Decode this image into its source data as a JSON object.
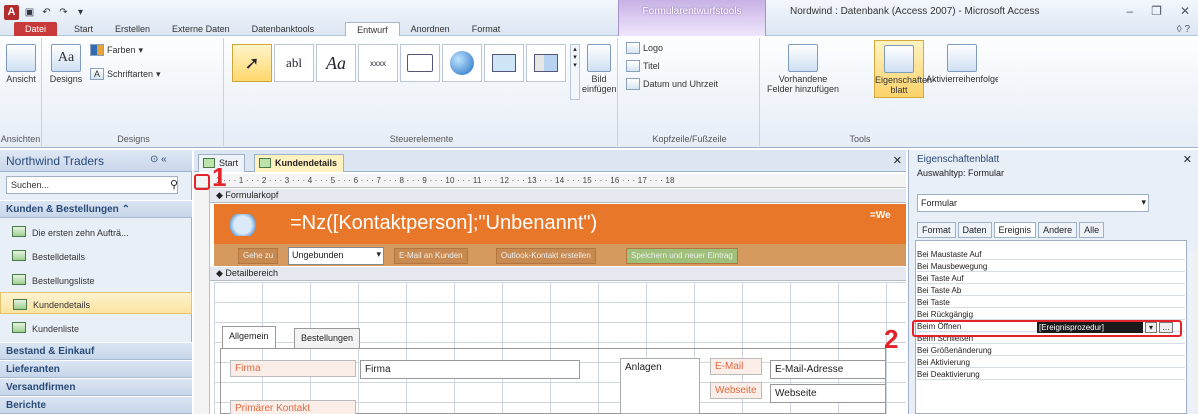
{
  "window": {
    "title": "Nordwind : Datenbank (Access 2007) - Microsoft Access",
    "context_tab_title": "Formularentwurfstools",
    "app_icon_label": "A"
  },
  "ribbon_tabs": [
    "Datei",
    "Start",
    "Erstellen",
    "Externe Daten",
    "Datenbanktools",
    "Entwurf",
    "Anordnen",
    "Format"
  ],
  "active_ribbon_tab": "Entwurf",
  "ribbon": {
    "ansichten": {
      "label": "Ansichten",
      "button": "Ansicht"
    },
    "designs": {
      "label": "Designs",
      "designs_btn": "Designs",
      "farben": "Farben",
      "schriftarten": "Schriftarten"
    },
    "steuerelemente": {
      "label": "Steuerelemente",
      "bild_einfuegen": "Bild einfügen",
      "ab_label": "abl",
      "aa_label": "Aa",
      "xxxx_label": "xxxx"
    },
    "kopfzeile": {
      "label": "Kopfzeile/Fußzeile",
      "logo": "Logo",
      "titel": "Titel",
      "datum": "Datum und Uhrzeit"
    },
    "tools": {
      "label": "Tools",
      "vorhandene": "Vorhandene Felder hinzufügen",
      "eigenschaften": "Eigenschaften-blatt",
      "aktivierreihenfolge": "Aktivierreihenfolge"
    }
  },
  "nav": {
    "title": "Northwind Traders",
    "search_placeholder": "Suchen...",
    "section_open": "Kunden & Bestellungen",
    "items": [
      "Die ersten zehn Aufträ...",
      "Bestelldetails",
      "Bestellungsliste",
      "Kundendetails",
      "Kundenliste"
    ],
    "selected_index": 3,
    "sections": [
      "Bestand & Einkauf",
      "Lieferanten",
      "Versandfirmen",
      "Berichte"
    ]
  },
  "document": {
    "tabs": [
      "Start",
      "Kundendetails"
    ],
    "active_tab": "Kundendetails",
    "ruler": "1 · · · 1 · · · 2 · · · 3 · · · 4 · · · 5 · · · 6 · · · 7 · · · 8 · · · 9 · · · 10 · · · 11 · · · 12 · · · 13 · · · 14 · · · 15 · · · 16 · · · 17 · · · 18",
    "section_formularkopf": "Formularkopf",
    "section_detailbereich": "Detailbereich",
    "header_expression": "=Nz([Kontaktperson];\"Unbenannt\")",
    "header_right": "=We",
    "gehe_zu": "Gehe zu",
    "combo_value": "Ungebunden",
    "buttons": [
      "E-Mail an Kunden",
      "Outlook-Kontakt erstellen",
      "Speichern und neuer Eintrag"
    ],
    "form_tabs": [
      "Allgemein",
      "Bestellungen"
    ],
    "fields": {
      "firma_label": "Firma",
      "firma_value": "Firma",
      "kontakt_label": "Primärer Kontakt",
      "anlagen": "Anlagen",
      "email_label": "E-Mail",
      "email_value": "E-Mail-Adresse",
      "webseite_label": "Webseite",
      "webseite_value": "Webseite"
    }
  },
  "properties": {
    "title": "Eigenschaftenblatt",
    "auswahltyp": "Auswahltyp: Formular",
    "object": "Formular",
    "tabs": [
      "Format",
      "Daten",
      "Ereignis",
      "Andere",
      "Alle"
    ],
    "active_tab": "Ereignis",
    "rows": [
      "Bei Maustaste Auf",
      "Bei Mausbewegung",
      "Bei Taste Auf",
      "Bei Taste Ab",
      "Bei Taste",
      "Bei Rückgängig",
      "Beim Öffnen",
      "Beim Schließen",
      "Bei Größenänderung",
      "Bei Aktivierung",
      "Bei Deaktivierung"
    ],
    "highlight_row": "Beim Öffnen",
    "highlight_value": "[Ereignisprozedur]"
  },
  "callouts": {
    "one": "1",
    "two": "2"
  },
  "colors": {
    "orange_header": "#e8772a",
    "callout_red": "#e3222a",
    "ctx_purple": "#c8b2e6"
  }
}
